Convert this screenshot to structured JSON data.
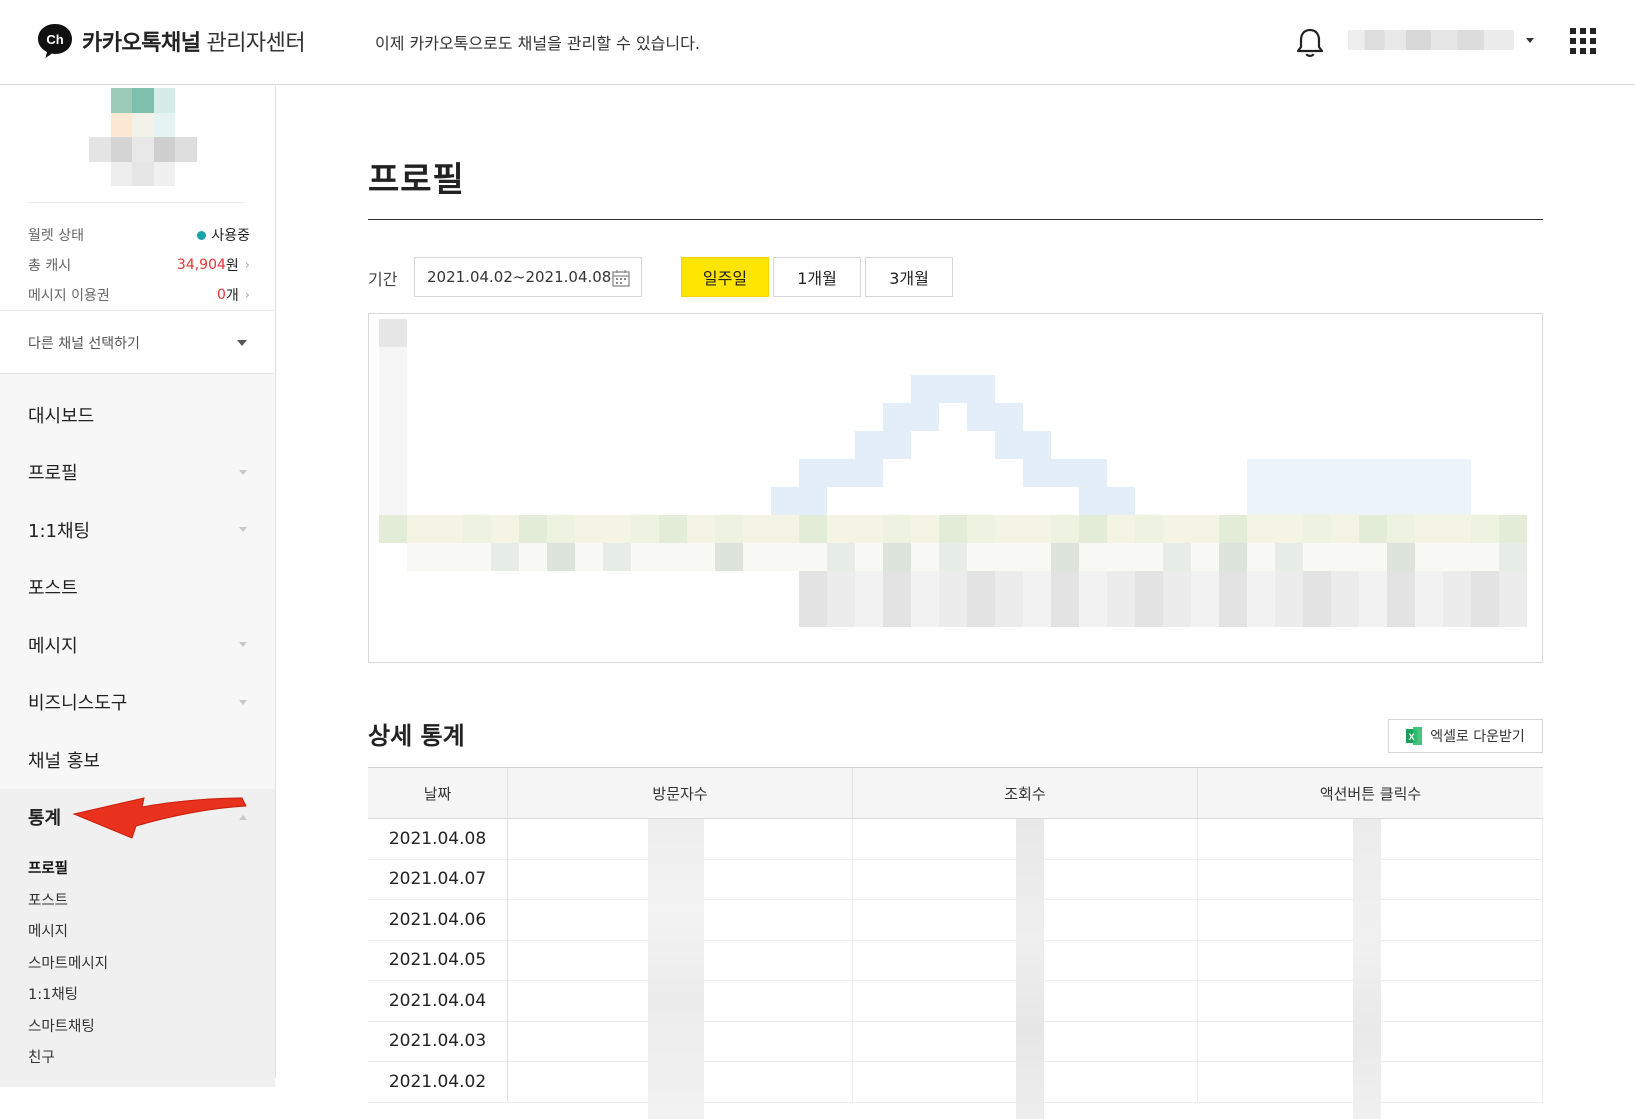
{
  "header": {
    "brand": "카카오톡채널",
    "brand_sub": "관리자센터",
    "logo_text": "Ch",
    "notice": "이제 카카오톡으로도 채널을 관리할 수 있습니다."
  },
  "sidebar": {
    "wallet": [
      {
        "label": "월렛 상태",
        "value": "사용중",
        "status_color": "#1aa3a8"
      },
      {
        "label": "총 캐시",
        "value": "34,904",
        "unit": "원"
      },
      {
        "label": "메시지 이용권",
        "value": "0",
        "unit": "개"
      }
    ],
    "channel_select": "다른 채널 선택하기",
    "menu": [
      {
        "label": "대시보드"
      },
      {
        "label": "프로필"
      },
      {
        "label": "1:1채팅"
      },
      {
        "label": "포스트"
      },
      {
        "label": "메시지"
      },
      {
        "label": "비즈니스도구"
      },
      {
        "label": "채널 홍보"
      },
      {
        "label": "통계"
      }
    ],
    "submenu": [
      "프로필",
      "포스트",
      "메시지",
      "스마트메시지",
      "1:1채팅",
      "스마트채팅",
      "친구"
    ]
  },
  "main": {
    "title": "프로필",
    "period_label": "기간",
    "date_range": "2021.04.02~2021.04.08",
    "period_buttons": [
      "일주일",
      "1개월",
      "3개월"
    ],
    "selected_period": "일주일",
    "detail_title": "상세 통계",
    "excel_button": "엑셀로 다운받기",
    "table": {
      "headers": [
        "날짜",
        "방문자수",
        "조회수",
        "액션버튼 클릭수"
      ],
      "dates": [
        "2021.04.08",
        "2021.04.07",
        "2021.04.06",
        "2021.04.05",
        "2021.04.04",
        "2021.04.03",
        "2021.04.02"
      ]
    }
  },
  "colors": {
    "accent_yellow": "#fee500",
    "arrow_red": "#e8321e",
    "cash_red": "#e33333"
  }
}
